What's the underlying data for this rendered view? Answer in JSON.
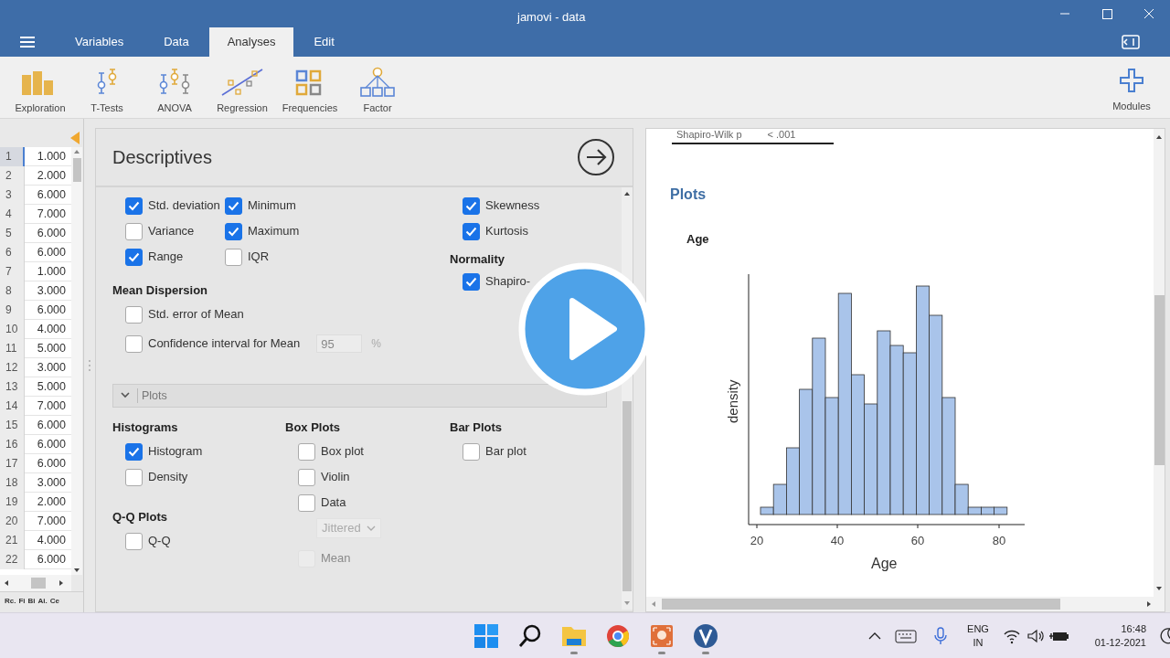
{
  "window": {
    "title": "jamovi - data"
  },
  "tabs": [
    {
      "label": "Variables",
      "selected": false
    },
    {
      "label": "Data",
      "selected": false
    },
    {
      "label": "Analyses",
      "selected": true
    },
    {
      "label": "Edit",
      "selected": false
    }
  ],
  "toolbar": [
    {
      "label": "Exploration",
      "kind": "exploration"
    },
    {
      "label": "T-Tests",
      "kind": "ttests"
    },
    {
      "label": "ANOVA",
      "kind": "anova"
    },
    {
      "label": "Regression",
      "kind": "regression"
    },
    {
      "label": "Frequencies",
      "kind": "frequencies"
    },
    {
      "label": "Factor",
      "kind": "factor"
    }
  ],
  "modules": {
    "label": "Modules"
  },
  "data_grid": {
    "rows": [
      {
        "n": "1",
        "value": "1.000",
        "selected": true
      },
      {
        "n": "2",
        "value": "2.000",
        "selected": false
      },
      {
        "n": "3",
        "value": "6.000",
        "selected": false
      },
      {
        "n": "4",
        "value": "7.000",
        "selected": false
      },
      {
        "n": "5",
        "value": "6.000",
        "selected": false
      },
      {
        "n": "6",
        "value": "6.000",
        "selected": false
      },
      {
        "n": "7",
        "value": "1.000",
        "selected": false
      },
      {
        "n": "8",
        "value": "3.000",
        "selected": false
      },
      {
        "n": "9",
        "value": "6.000",
        "selected": false
      },
      {
        "n": "10",
        "value": "4.000",
        "selected": false
      },
      {
        "n": "11",
        "value": "5.000",
        "selected": false
      },
      {
        "n": "12",
        "value": "3.000",
        "selected": false
      },
      {
        "n": "13",
        "value": "5.000",
        "selected": false
      },
      {
        "n": "14",
        "value": "7.000",
        "selected": false
      },
      {
        "n": "15",
        "value": "6.000",
        "selected": false
      },
      {
        "n": "16",
        "value": "6.000",
        "selected": false
      },
      {
        "n": "17",
        "value": "6.000",
        "selected": false
      },
      {
        "n": "18",
        "value": "3.000",
        "selected": false
      },
      {
        "n": "19",
        "value": "2.000",
        "selected": false
      },
      {
        "n": "20",
        "value": "7.000",
        "selected": false
      },
      {
        "n": "21",
        "value": "4.000",
        "selected": false
      },
      {
        "n": "22",
        "value": "6.000",
        "selected": false
      }
    ],
    "status_items": [
      "Rc.",
      "Fi",
      "Bi",
      "Ai.",
      "Ce"
    ]
  },
  "options": {
    "title": "Descriptives",
    "stats_left": [
      {
        "label": "Std. deviation",
        "checked": true
      },
      {
        "label": "Minimum",
        "checked": true
      },
      {
        "label": "Variance",
        "checked": false
      },
      {
        "label": "Maximum",
        "checked": true
      },
      {
        "label": "Range",
        "checked": true
      },
      {
        "label": "IQR",
        "checked": false
      }
    ],
    "mean_dispersion": {
      "heading": "Mean Dispersion",
      "items": [
        {
          "label": "Std. error of Mean",
          "checked": false
        },
        {
          "label": "Confidence interval for Mean",
          "checked": false,
          "value": "95",
          "unit": "%"
        }
      ]
    },
    "stats_right": [
      {
        "label": "Skewness",
        "checked": true
      },
      {
        "label": "Kurtosis",
        "checked": true
      }
    ],
    "normality": {
      "heading": "Normality",
      "items": [
        {
          "label": "Shapiro-",
          "checked": true
        }
      ]
    },
    "plots_section": {
      "label": "Plots",
      "expanded": true,
      "columns": [
        [
          {
            "heading": "Histograms",
            "items": [
              {
                "kind": "checkbox",
                "label": "Histogram",
                "checked": true,
                "disabled": false
              },
              {
                "kind": "checkbox",
                "label": "Density",
                "checked": false,
                "disabled": false
              }
            ]
          },
          {
            "heading": "Q-Q Plots",
            "items": [
              {
                "kind": "checkbox",
                "label": "Q-Q",
                "checked": false,
                "disabled": false
              }
            ]
          }
        ],
        [
          {
            "heading": "Box Plots",
            "items": [
              {
                "kind": "checkbox",
                "label": "Box plot",
                "checked": false,
                "disabled": false
              },
              {
                "kind": "checkbox",
                "label": "Violin",
                "checked": false,
                "disabled": false
              },
              {
                "kind": "checkbox",
                "label": "Data",
                "checked": false,
                "disabled": false
              },
              {
                "kind": "dropdown",
                "value": "Jittered",
                "disabled": true
              },
              {
                "kind": "checkbox",
                "label": "Mean",
                "checked": false,
                "disabled": true
              }
            ]
          }
        ],
        [
          {
            "heading": "Bar Plots",
            "items": [
              {
                "kind": "checkbox",
                "label": "Bar plot",
                "checked": false,
                "disabled": false
              }
            ]
          }
        ]
      ]
    }
  },
  "results": {
    "table_row": {
      "label": "Shapiro-Wilk p",
      "value": "< .001"
    },
    "heading": "Plots",
    "plot_title": "Age",
    "histogram": {
      "xlabel": "Age",
      "ylabel": "density",
      "x_tick_labels": [
        "20",
        "40",
        "60",
        "80"
      ]
    }
  },
  "taskbar": {
    "language": [
      "ENG",
      "IN"
    ],
    "time": "16:48",
    "date": "01-12-2021"
  }
}
